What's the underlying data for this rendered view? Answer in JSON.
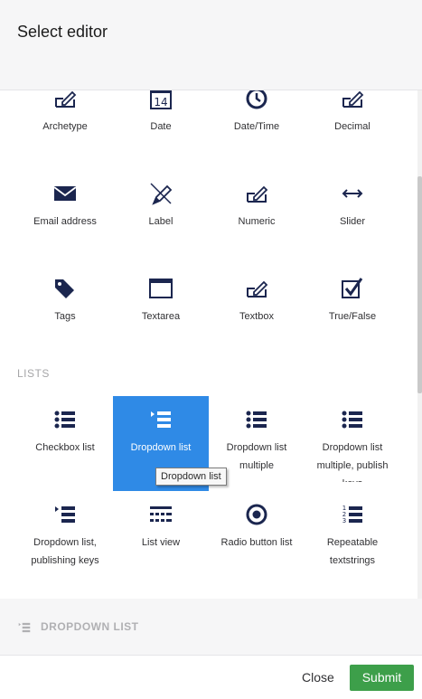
{
  "header": {
    "title": "Select editor"
  },
  "row_top": [
    {
      "label": "Archetype",
      "icon": "pencil-square-icon"
    },
    {
      "label": "Date",
      "icon": "calendar-icon"
    },
    {
      "label": "Date/Time",
      "icon": "clock-icon"
    },
    {
      "label": "Decimal",
      "icon": "pencil-square-icon"
    }
  ],
  "row_two": [
    {
      "label": "Email address",
      "icon": "envelope-icon"
    },
    {
      "label": "Label",
      "icon": "pen-icon"
    },
    {
      "label": "Numeric",
      "icon": "pencil-square-icon"
    },
    {
      "label": "Slider",
      "icon": "arrows-horizontal-icon"
    }
  ],
  "row_three": [
    {
      "label": "Tags",
      "icon": "tags-icon"
    },
    {
      "label": "Textarea",
      "icon": "window-icon"
    },
    {
      "label": "Textbox",
      "icon": "pencil-square-icon"
    },
    {
      "label": "True/False",
      "icon": "checkbox-icon"
    }
  ],
  "lists_section": {
    "title": "LISTS",
    "row_one": [
      {
        "label": "Checkbox list",
        "icon": "bulleted-list-icon"
      },
      {
        "label": "Dropdown list",
        "icon": "dropdown-list-icon"
      },
      {
        "label": "Dropdown list multiple",
        "icon": "bulleted-list-icon"
      },
      {
        "label": "Dropdown list multiple, publish keys",
        "icon": "bulleted-list-icon"
      }
    ],
    "row_two": [
      {
        "label": "Dropdown list, publishing keys",
        "icon": "dropdown-list-icon"
      },
      {
        "label": "List view",
        "icon": "list-view-icon"
      },
      {
        "label": "Radio button list",
        "icon": "radio-icon"
      },
      {
        "label": "Repeatable textstrings",
        "icon": "numbered-list-icon"
      }
    ]
  },
  "tooltip": {
    "text": "Dropdown list"
  },
  "selected": {
    "label": "DROPDOWN LIST",
    "icon": "dropdown-list-icon"
  },
  "footer": {
    "close_label": "Close",
    "submit_label": "Submit"
  },
  "colors": {
    "accent": "#2f8ae6",
    "submit": "#3d9f4a",
    "icon": "#1b264f"
  }
}
